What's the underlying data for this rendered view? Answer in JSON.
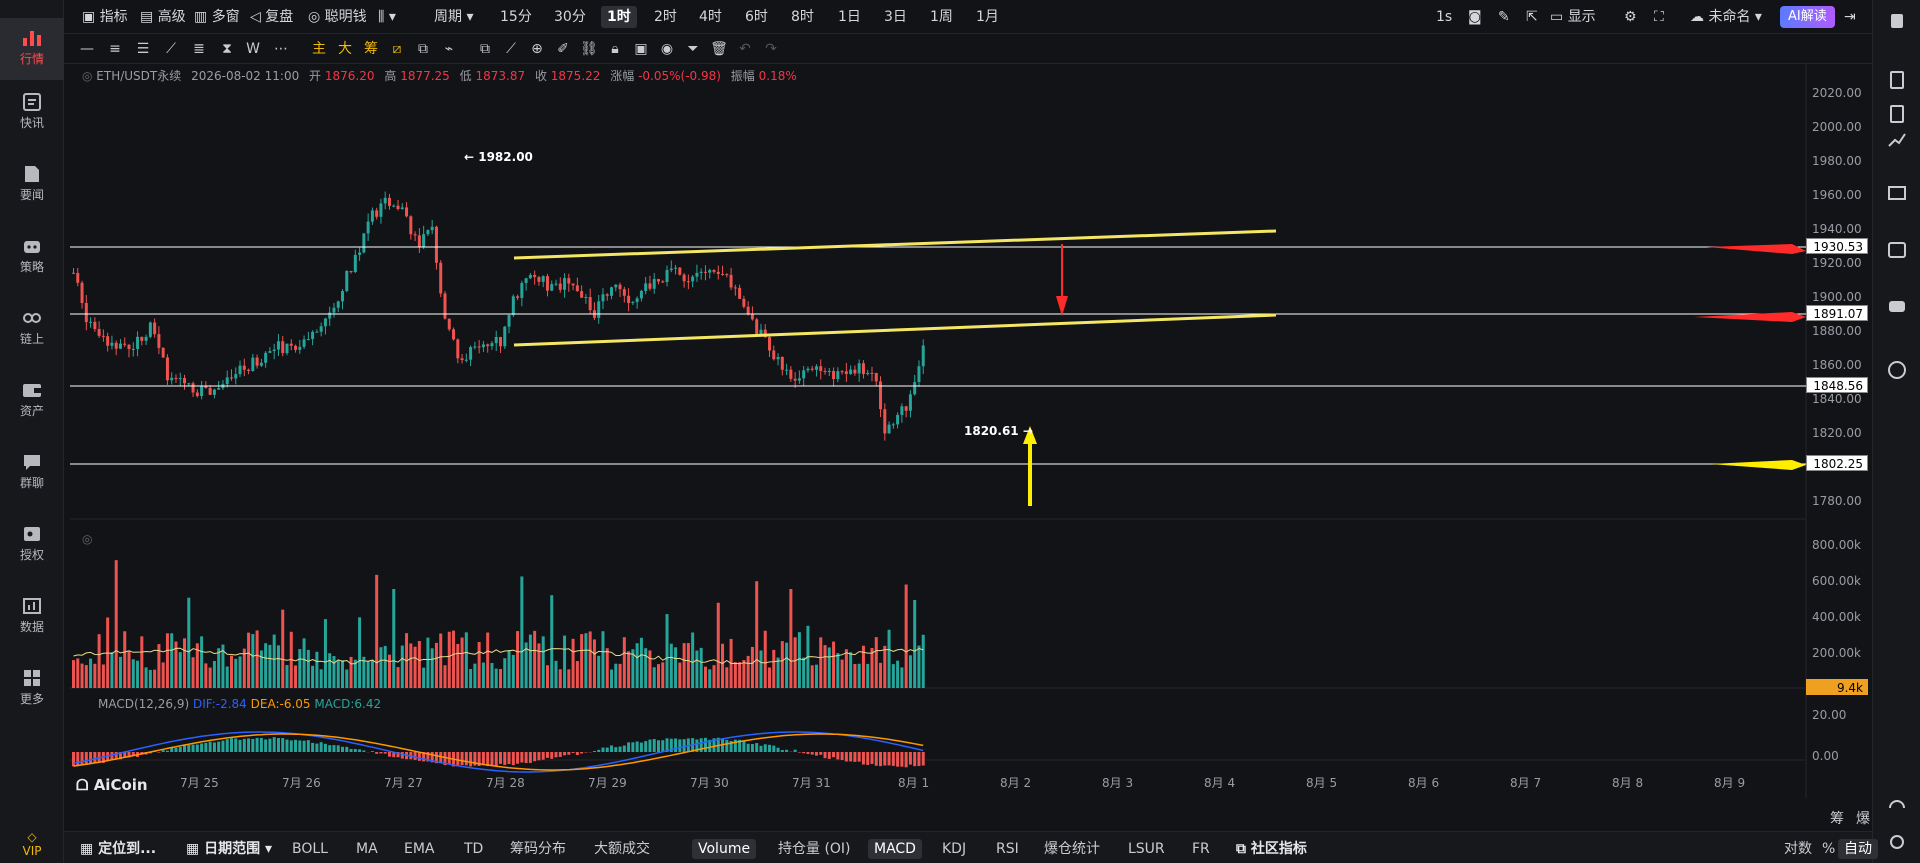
{
  "nav": {
    "items": [
      {
        "label": "行情",
        "icon": "bar-chart-icon"
      },
      {
        "label": "快讯",
        "icon": "news-flash-icon"
      },
      {
        "label": "要闻",
        "icon": "newspaper-icon"
      },
      {
        "label": "策略",
        "icon": "robot-icon"
      },
      {
        "label": "链上",
        "icon": "chain-icon"
      },
      {
        "label": "资产",
        "icon": "wallet-icon"
      },
      {
        "label": "群聊",
        "icon": "chat-icon"
      },
      {
        "label": "授权",
        "icon": "key-icon"
      },
      {
        "label": "数据",
        "icon": "data-icon"
      },
      {
        "label": "更多",
        "icon": "grid-icon"
      }
    ],
    "vip": "VIP"
  },
  "topbar": {
    "indicator": "指标",
    "advanced": "高级",
    "multi_window": "多窗",
    "replay": "复盘",
    "smart_money": "聪明钱",
    "period": "周期",
    "timeframes": [
      "15分",
      "30分",
      "1时",
      "2时",
      "4时",
      "6时",
      "8时",
      "1日",
      "3日",
      "1周",
      "1月"
    ],
    "selected_timeframe": "1时",
    "refresh": "1s",
    "display": "显示",
    "layout_name": "未命名",
    "ai": "AI解读"
  },
  "drawbar": {
    "w_label": "W",
    "main": "主",
    "big": "大",
    "chip": "筹"
  },
  "legend": {
    "symbol": "ETH/USDT永续",
    "datetime": "2026-08-02 11:00",
    "open_label": "开",
    "open": "1876.20",
    "high_label": "高",
    "high": "1877.25",
    "low_label": "低",
    "low": "1873.87",
    "close_label": "收",
    "close": "1875.22",
    "change_label": "涨幅",
    "change": "-0.05%(-0.98)",
    "amp_label": "振幅",
    "amp": "0.18%"
  },
  "macd_legend": {
    "name": "MACD(12,26,9)",
    "dif": "DIF:-2.84",
    "dea": "DEA:-6.05",
    "macd": "MACD:6.42"
  },
  "annotations": {
    "high": "1982.00",
    "low": "1820.61"
  },
  "price_tags": [
    "1930.53",
    "1891.07",
    "1848.56",
    "1802.25"
  ],
  "volume_tag": "9.4k",
  "price_axis": [
    "2020.00",
    "2000.00",
    "1980.00",
    "1960.00",
    "1940.00",
    "1920.00",
    "1900.00",
    "1880.00",
    "1860.00",
    "1840.00",
    "1820.00",
    "1780.00"
  ],
  "volume_axis": [
    "800.00k",
    "600.00k",
    "400.00k",
    "200.00k"
  ],
  "macd_axis": [
    "20.00",
    "0.00"
  ],
  "dates": [
    "7月 25",
    "7月 26",
    "7月 27",
    "7月 28",
    "7月 29",
    "7月 30",
    "7月 31",
    "8月 1",
    "8月 2",
    "8月 3",
    "8月 4",
    "8月 5",
    "8月 6",
    "8月 7",
    "8月 8",
    "8月 9"
  ],
  "corner_labels": [
    "筹",
    "爆"
  ],
  "logo": "AiCoin",
  "colors": {
    "up": "#26a69a",
    "down": "#ef5350",
    "channel": "#f5e663",
    "red_arrow": "#ff2b2b",
    "yellow_arrow": "#ffee00",
    "ma": "#e8d98a",
    "dif": "#2962ff",
    "dea": "#ff9800"
  },
  "bottombar": {
    "locate": "定位到...",
    "date_range": "日期范围",
    "indicators": [
      "BOLL",
      "MA",
      "EMA",
      "TD",
      "筹码分布",
      "大额成交"
    ],
    "sub_indicators": [
      "Volume",
      "持仓量 (OI)",
      "MACD",
      "KDJ",
      "RSI",
      "爆仓统计",
      "LSUR",
      "FR"
    ],
    "selected_sub": [
      "Volume",
      "MACD"
    ],
    "community": "社区指标",
    "log": "对数",
    "percent": "%",
    "auto": "自动"
  }
}
